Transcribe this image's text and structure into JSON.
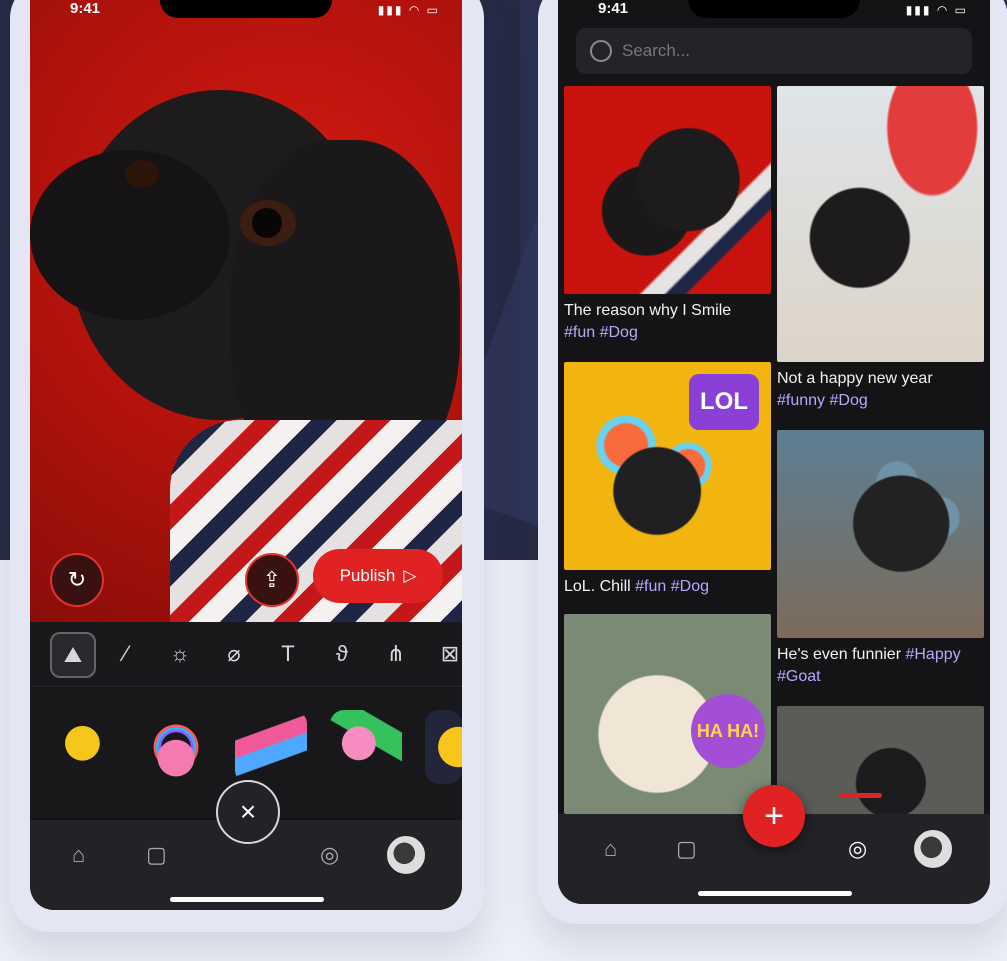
{
  "status": {
    "time": "9:41"
  },
  "editor": {
    "publish_label": "Publish",
    "tools": [
      "image-tool",
      "brush-tool",
      "light-tool",
      "bandage-tool",
      "text-tool",
      "blend-tool",
      "network-tool",
      "frame-tool"
    ],
    "text_tool_glyph": "T",
    "stickers": [
      "idea-sticker",
      "brain-sticker",
      "paint-sticker",
      "piggy-bank-sticker",
      "sticker-partial"
    ]
  },
  "feed": {
    "search_placeholder": "Search...",
    "posts": [
      {
        "caption": "The reason why I Smile",
        "tags": "#fun #Dog"
      },
      {
        "caption": "Not a happy new year",
        "tags": "#funny #Dog"
      },
      {
        "caption": "LoL. Chill",
        "tags": "#fun #Dog"
      },
      {
        "caption": "He's even funnier",
        "tags": "#Happy #Goat"
      },
      {
        "caption": "",
        "tags": ""
      },
      {
        "caption": "",
        "tags": ""
      }
    ],
    "stickers": {
      "lol": "LOL",
      "haha": "HA HA!"
    }
  },
  "nav": {
    "close": "×",
    "plus": "+"
  }
}
